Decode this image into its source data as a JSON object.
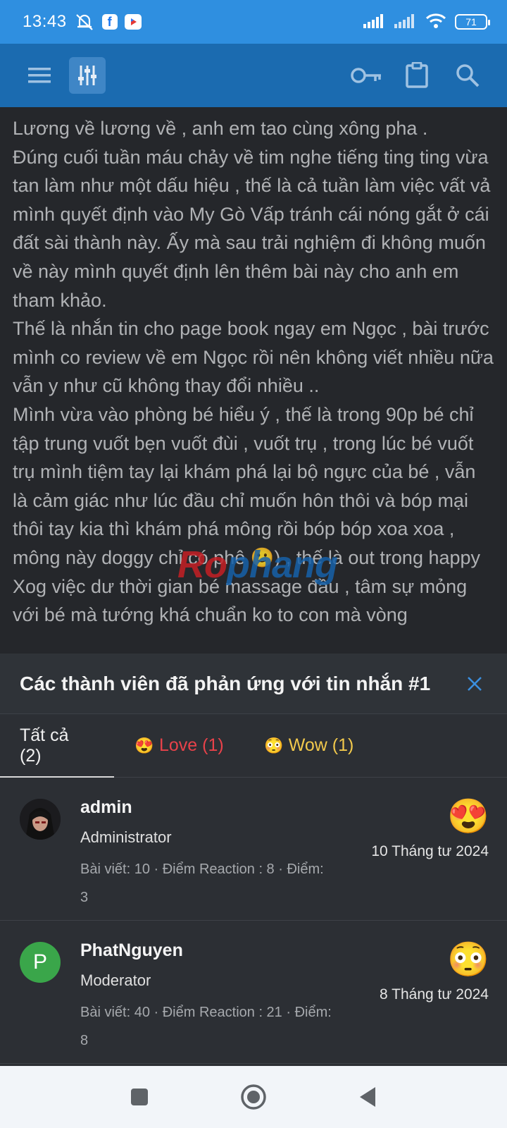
{
  "status_bar": {
    "time": "13:43",
    "battery": "71",
    "icons": [
      "mute-bell-icon",
      "facebook-icon",
      "youtube-icon",
      "signal-icon",
      "signal-icon",
      "wifi-icon",
      "battery-icon"
    ]
  },
  "app_bar": {
    "icons": [
      "menu-icon",
      "filter-icon",
      "key-icon",
      "clipboard-icon",
      "search-icon"
    ]
  },
  "post": {
    "paragraphs": [
      "Lương về lương về , anh em tao cùng xông pha .",
      "Đúng cuối tuần máu chảy về tim nghe tiếng ting ting vừa tan làm như một dấu hiệu , thế là cả tuần làm việc vất vả mình quyết định vào My Gò Vấp tránh cái nóng gắt ở cái đất sài thành này. Ấy mà sau trải nghiệm đi không muốn về này mình quyết định lên thêm bài này cho anh em tham khảo.",
      "Thế là nhắn tin cho page book ngay em Ngọc , bài trước mình co review về em Ngọc rồi nên không viết nhiều nữa vẫn y như cũ không thay đổi nhiều ..",
      "Mình vừa vào phòng bé hiểu ý , thế là trong 90p bé chỉ tập trung vuốt bẹn vuốt đùi , vuốt trụ , trong lúc bé vuốt trụ mình tiệm tay lại khám phá lại bộ ngực của bé , vẫn là cảm giác như lúc đầu chỉ muốn hôn thôi và bóp mại thôi tay kia thì khám phá mông rồi bóp bóp xoa xoa , mông này doggy chỉ có phê 🙂) , thế là out trong happy",
      "Xog việc dư thời gian bé massage đầu , tâm sự mỏng với bé mà tướng khá chuẩn ko to con mà vòng"
    ],
    "watermark": {
      "part1": "Ro",
      "part2": "phang"
    }
  },
  "sheet": {
    "title": "Các thành viên đã phản ứng với tin nhắn #1",
    "tabs": {
      "all": "Tất cả (2)",
      "love": "Love (1)",
      "wow": "Wow (1)"
    },
    "members": [
      {
        "name": "admin",
        "role": "Administrator",
        "stats": "Bài viết: 10 · Điểm Reaction : 8 · Điểm: 3",
        "date": "10 Tháng tư 2024",
        "reaction": "😍"
      },
      {
        "name": "PhatNguyen",
        "initial": "P",
        "role": "Moderator",
        "stats": "Bài viết: 40 · Điểm Reaction : 21 · Điểm: 8",
        "date": "8 Tháng tư 2024",
        "reaction": "😳"
      }
    ]
  },
  "colors": {
    "status_bar": "#2f8fe0",
    "app_bar": "#1b6bb0",
    "sheet_bg": "#2c2f34",
    "love": "#e8424a",
    "wow": "#f2c94c",
    "accent": "#3a8fe0"
  }
}
